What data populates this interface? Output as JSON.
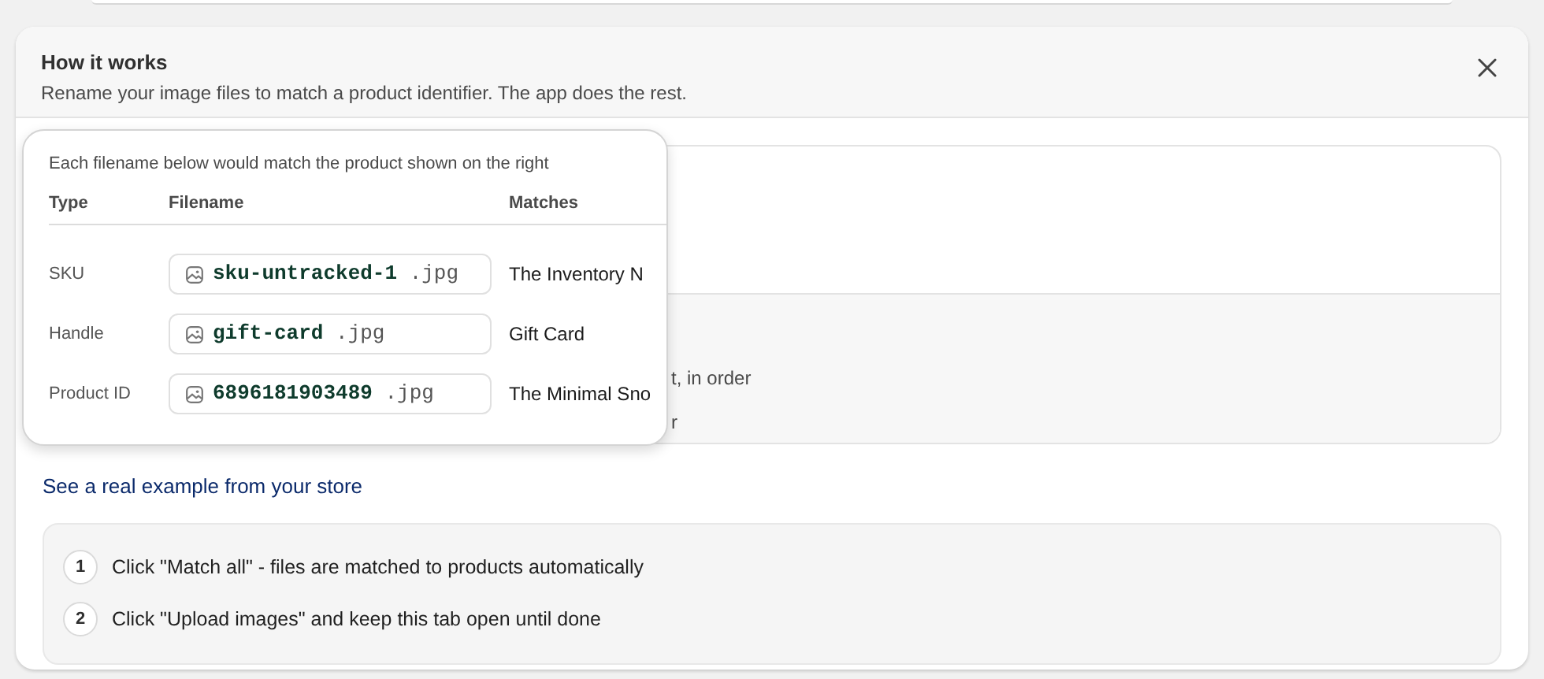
{
  "header": {
    "title": "How it works",
    "subtitle": "Rename your image files to match a product identifier. The app does the rest."
  },
  "behind_panel": {
    "lines": [
      "t, in order",
      "r"
    ]
  },
  "popover": {
    "caption": "Each filename below would match the product shown on the right",
    "columns": [
      "Type",
      "Filename",
      "Matches"
    ],
    "rows": [
      {
        "type": "SKU",
        "filename": "**sku-untracked-1** .jpg",
        "match": "The Inventory N"
      },
      {
        "type": "Handle",
        "filename": "**gift-card** .jpg",
        "match": "Gift Card"
      },
      {
        "type": "Product ID",
        "filename": "**6896181903489** .jpg",
        "match": "The Minimal Sno"
      }
    ]
  },
  "example_link": "See a real example from your store",
  "steps": [
    {
      "number": "1",
      "text": "Click \"Match all\" - files are matched to products automatically"
    },
    {
      "number": "2",
      "text": "Click \"Upload images\" and keep this tab open until done"
    }
  ]
}
